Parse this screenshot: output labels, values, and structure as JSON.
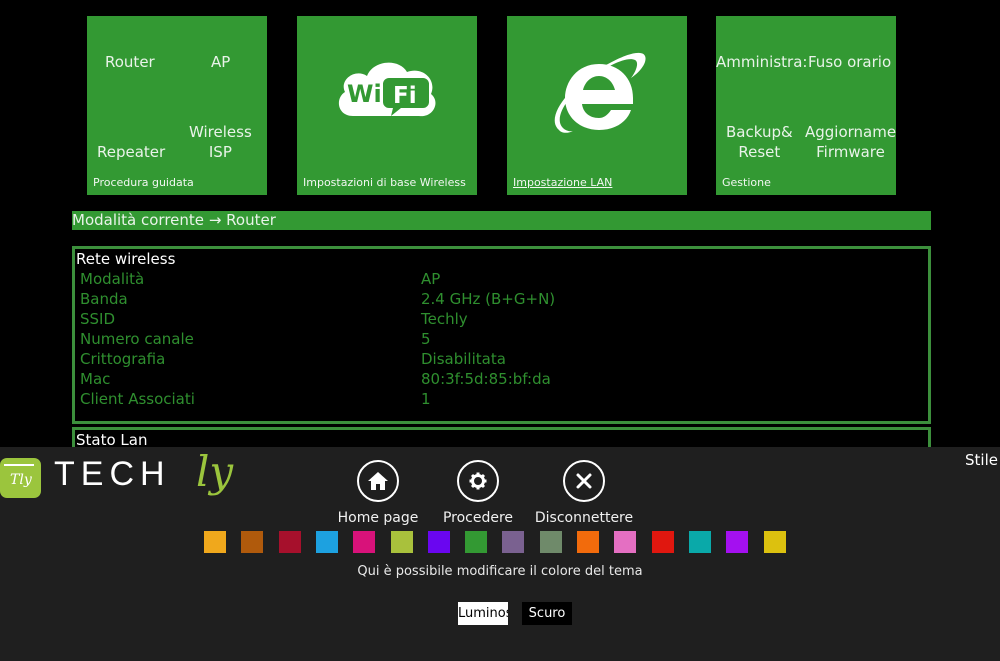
{
  "tiles": [
    {
      "name": "wizard",
      "caption": "Procedura guidata",
      "options": [
        "Router",
        "AP",
        "Repeater",
        "Wireless",
        "ISP"
      ]
    },
    {
      "name": "wireless",
      "caption": "Impostazioni di base Wireless",
      "icon": "wifi-icon",
      "icon_text_a": "Wi",
      "icon_text_b": "Fi"
    },
    {
      "name": "lan",
      "caption": "Impostazione LAN",
      "icon": "internet-explorer-icon"
    },
    {
      "name": "management",
      "caption": "Gestione",
      "options": [
        "Amministra:",
        "Fuso orario",
        "Backup&",
        "Reset",
        "Aggiorname",
        "Firmware"
      ]
    }
  ],
  "mode_bar": {
    "label": "Modalità corrente",
    "arrow": "→",
    "value": "Router"
  },
  "wireless_panel": {
    "title": "Rete wireless",
    "rows": [
      {
        "key": "Modalità",
        "value": "AP"
      },
      {
        "key": "Banda",
        "value": "2.4 GHz (B+G+N)"
      },
      {
        "key": "SSID",
        "value": "Techly"
      },
      {
        "key": "Numero canale",
        "value": "5"
      },
      {
        "key": "Crittografia",
        "value": "Disabilitata"
      },
      {
        "key": "Mac",
        "value": "80:3f:5d:85:bf:da"
      },
      {
        "key": "Client Associati",
        "value": "1"
      }
    ]
  },
  "lan_panel": {
    "title": "Stato Lan"
  },
  "bottom_bar": {
    "logo_text": "TECH",
    "logo_suffix": "ly",
    "logo_badge": "Tly",
    "nav": [
      {
        "label": "Home page",
        "icon": "home-icon"
      },
      {
        "label": "Procedere",
        "icon": "gear-icon"
      },
      {
        "label": "Disconnettere",
        "icon": "close-icon"
      }
    ],
    "swatches": [
      "#f0a81c",
      "#b05a0c",
      "#a6102c",
      "#1da1e0",
      "#d8127a",
      "#a9c13c",
      "#6a06f0",
      "#339933",
      "#7a6190",
      "#6f8a6a",
      "#f26b0c",
      "#e46fc2",
      "#e0170f",
      "#0aa9a9",
      "#a410f0",
      "#dcc10f"
    ],
    "hint": "Qui è possibile modificare il colore del tema",
    "style_label": "Stile",
    "style_options": [
      {
        "label": "Luminoso",
        "state": "selected"
      },
      {
        "label": "Scuro",
        "state": "unselected"
      }
    ]
  },
  "colors": {
    "accent": "#339933",
    "panel_border": "#3c8f3c",
    "value_text": "#2f8f2f",
    "bottom_bg": "#1f1f1f"
  }
}
